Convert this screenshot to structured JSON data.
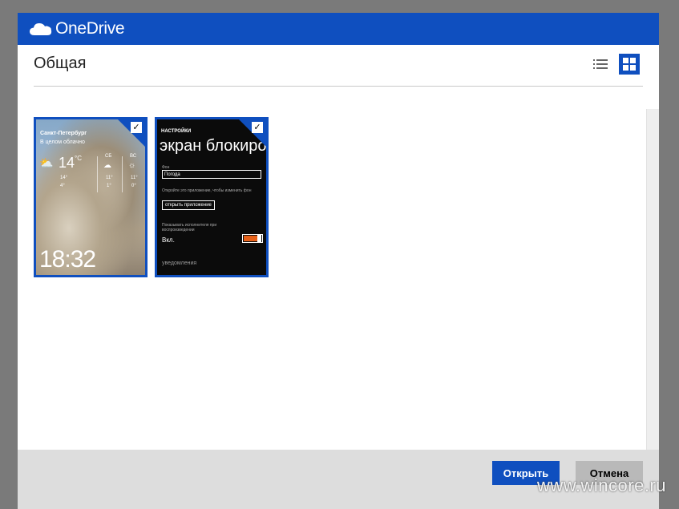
{
  "app": {
    "brand": "OneDrive",
    "accent": "#0f4fbf"
  },
  "header": {
    "title": "Общая",
    "views": [
      "list-view",
      "grid-view"
    ],
    "selected_view": "grid-view"
  },
  "files": [
    {
      "type": "weather-screenshot",
      "selected": true,
      "city": "Санкт-Петербург",
      "condition": "В целом облачно",
      "temp": "14",
      "temp_unit": "°C",
      "today_hi": "14°",
      "today_lo": "4°",
      "day2": "СБ",
      "day2_hi": "11°",
      "day2_lo": "1°",
      "day3": "ВС",
      "day3_hi": "11°",
      "day3_lo": "0°",
      "clock": "18:32"
    },
    {
      "type": "settings-screenshot",
      "selected": true,
      "heading": "НАСТРОЙКИ",
      "title": "экран блокировки",
      "background_label": "Фон",
      "background_value": "Погода",
      "open_app_hint": "Откройте это приложение, чтобы изменить фон",
      "open_app_button": "открыть приложение",
      "artist_label": "Показывать исполнителя при воспроизведении",
      "artist_value": "Вкл.",
      "notifications": "уведомления"
    }
  ],
  "footer": {
    "open": "Открыть",
    "cancel": "Отмена"
  },
  "watermark": "www.wincore.ru"
}
